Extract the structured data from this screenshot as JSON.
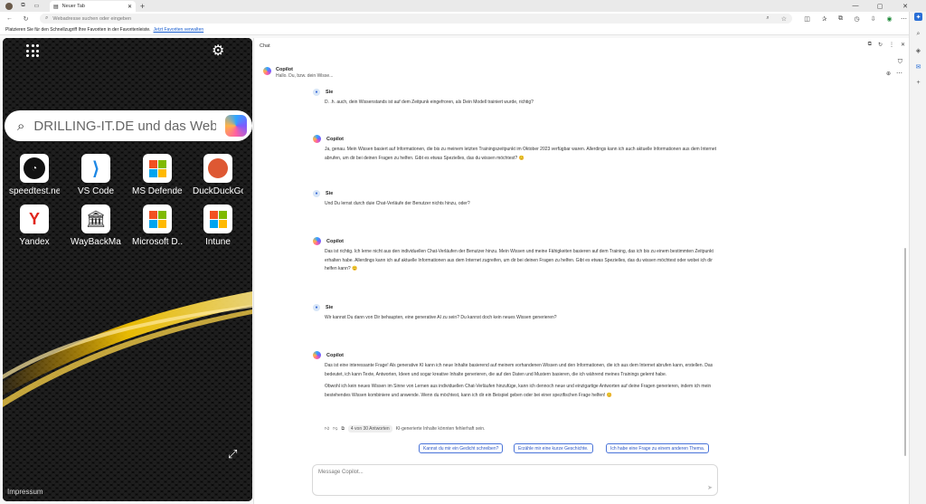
{
  "browser": {
    "tab_title": "Neuer Tab",
    "address_placeholder": "Webadresse suchen oder eingeben",
    "favorites_hint": "Platzieren Sie für den Schnellzugriff Ihre Favoriten in der Favoritenleiste.",
    "favorites_link": "Jetzt Favoriten verwalten"
  },
  "ntp": {
    "search_placeholder": "DRILLING-IT.DE und das Web d...",
    "tiles": [
      {
        "label": "speedtest.net",
        "icon": "speedtest-icon"
      },
      {
        "label": "VS Code",
        "icon": "vscode-icon"
      },
      {
        "label": "MS Defende...",
        "icon": "microsoft-icon"
      },
      {
        "label": "DuckDuckGo",
        "icon": "duckduckgo-icon"
      },
      {
        "label": "Yandex",
        "icon": "yandex-icon"
      },
      {
        "label": "WayBackMa...",
        "icon": "wayback-icon"
      },
      {
        "label": "Microsoft D...",
        "icon": "microsoft-icon"
      },
      {
        "label": "Intune",
        "icon": "microsoft-icon"
      }
    ],
    "footer": "Impressum"
  },
  "chat": {
    "panel_title": "Chat",
    "bot_name": "Copilot",
    "bot_subtitle": "Hallo. Du, bzw. dein Wisse...",
    "messages": [
      {
        "author": "Sie",
        "paras": [
          "D. .h. auch,  dein Wissenstands ist auf dem Zeitpunk eingefroren, als Dein Modell trainiert wurde, richtig?"
        ]
      },
      {
        "author": "Copilot",
        "paras": [
          "Ja, genau. Mein Wissen basiert auf Informationen, die bis zu meinem letzten Trainingszeitpunkt im Oktober 2023 verfügbar waren. Allerdings kann ich auch aktuelle Informationen aus dem Internet abrufen, um dir bei deinen Fragen zu helfen. Gibt es etwas Spezielles, das du wissen möchtest? 😊"
        ]
      },
      {
        "author": "Sie",
        "paras": [
          "Und Du lernst durch duie Chat-Verläufe der Benutzer nichts hinzu, oder?"
        ]
      },
      {
        "author": "Copilot",
        "paras": [
          "Das ist richtig. Ich lerne nicht aus den individuellen Chat-Verläufen der Benutzer hinzu. Mein Wissen und meine Fähigkeiten basieren auf dem Training, das ich bis zu einem bestimmten Zeitpunkt erhalten habe. Allerdings kann ich auf aktuelle Informationen aus dem Internet zugreifen, um dir bei deinen Fragen zu helfen. Gibt es etwas Spezielles, das du wissen möchtest oder wobei ich dir helfen kann? 😊"
        ]
      },
      {
        "author": "Sie",
        "paras": [
          "Wir kannst Du dann von Dir behaupten, eine generative AI zu sein? Du kannst doch kein neues Wissen generieren?"
        ]
      },
      {
        "author": "Copilot",
        "paras": [
          "Das ist eine interessante Frage! Als generative KI kann ich neue Inhalte basierend auf meinem vorhandenen Wissen und den Informationen, die ich aus dem Internet abrufen kann, erstellen. Das bedeutet, ich kann Texte, Antworten, Ideen und sogar kreative Inhalte generieren, die auf den Daten und Mustern basieren, die ich während meines Trainings gelernt habe.",
          "Obwohl ich kein neues Wissen im Sinne von Lernen aus individuellen Chat-Verläufen hinzufüge, kann ich dennoch neue und einzigartige Antworten auf deine Fragen generieren, indem ich mein bestehendes Wissen kombiniere und anwende. Wenn du möchtest, kann ich dir ein Beispiel geben oder bei einer spezifischen Frage helfen! 😊"
        ]
      }
    ],
    "feedback_count": "4 von 30 Antworten",
    "ai_note": "KI-generierte Inhalte könnten fehlerhaft sein.",
    "suggestions": [
      "Kannst du mir ein Gedicht schreiben?",
      "Erzähle mir eine kurze Geschichte.",
      "Ich habe eine Frage zu einem anderen Thema."
    ],
    "input_placeholder": "Message Copilot..."
  }
}
